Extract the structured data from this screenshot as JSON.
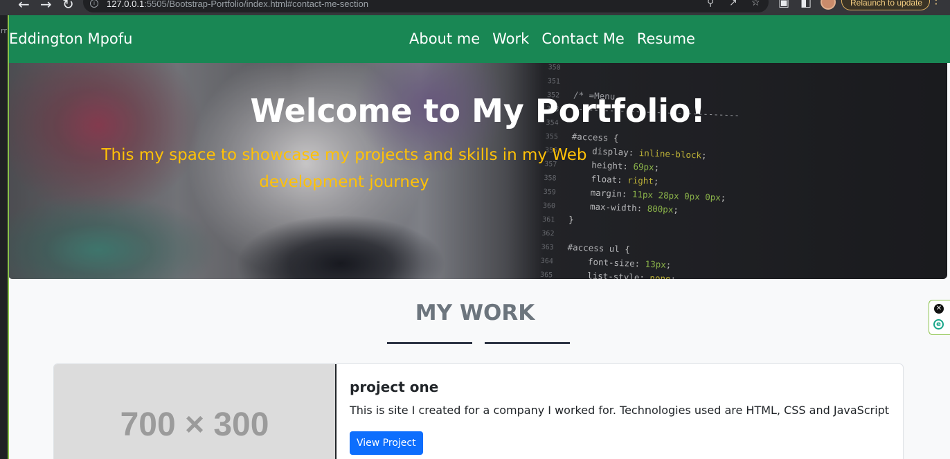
{
  "browser": {
    "url_host": "127.0.0.1",
    "url_path": ":5505/Bootstrap-Portfolio/index.html#contact-me-section",
    "relaunch_label": "Relaunch to update",
    "left_letter": "rr"
  },
  "navbar": {
    "brand": "Eddington Mpofu",
    "links": [
      "About me",
      "Work",
      "Contact Me",
      "Resume"
    ]
  },
  "hero": {
    "title": "Welcome to My Portfolio!",
    "subtitle": "This my space to showcase my projects and skills in my Web development journey"
  },
  "work": {
    "title": "MY WORK",
    "card": {
      "image_placeholder": "700 × 300",
      "title": "project one",
      "text": "This is site I created for a company I worked for. Technologies used are HTML, CSS and JavaScript",
      "button": "View Project"
    }
  },
  "colors": {
    "navbar": "#198754",
    "accent_yellow": "#ffc107",
    "button_blue": "#0d6efd"
  }
}
